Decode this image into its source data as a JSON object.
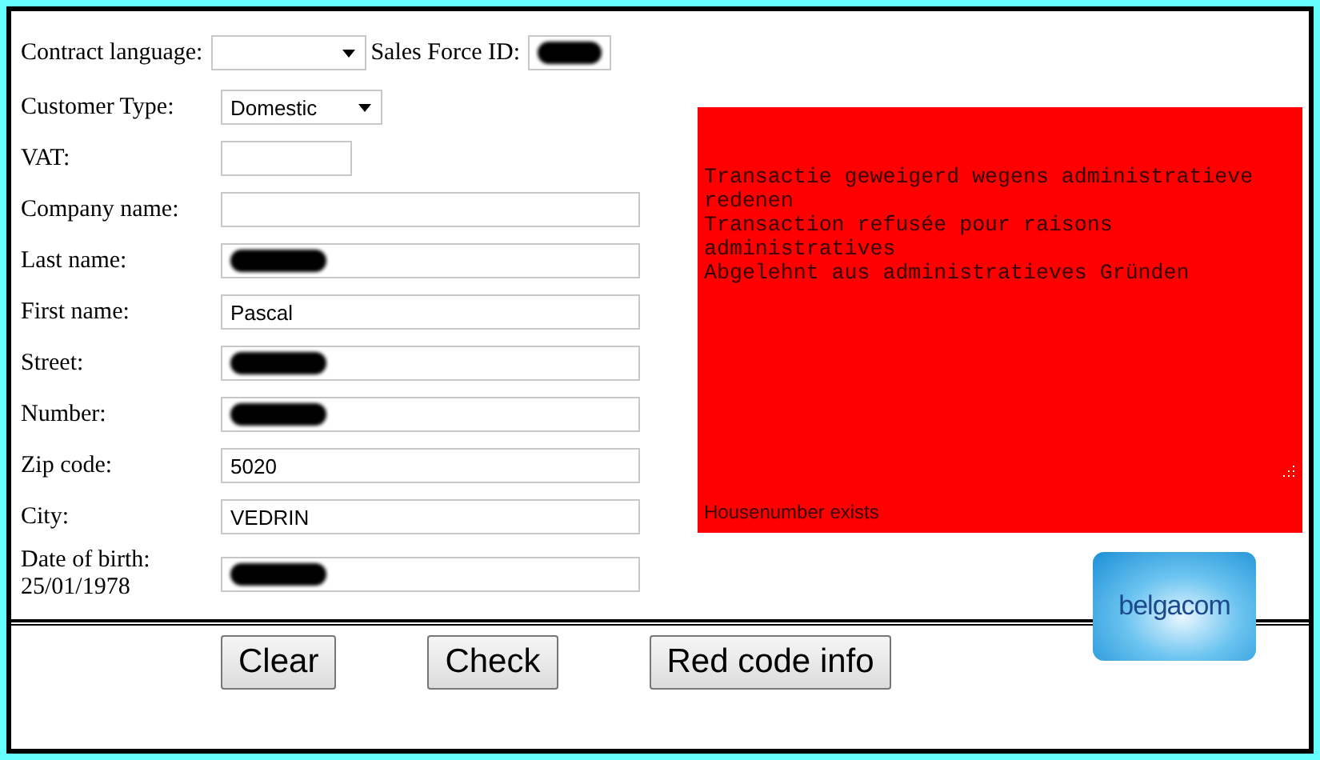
{
  "top_row": [
    {
      "kind": "select",
      "label": "Contract language:"
    },
    {
      "kind": "input",
      "label": "Sales Force ID:",
      "redacted": true
    }
  ],
  "fields": [
    {
      "kind": "select",
      "label": "Customer Type:",
      "value": "Domestic"
    },
    {
      "kind": "short",
      "label": "VAT:"
    },
    {
      "kind": "text",
      "label": "Company name:"
    },
    {
      "kind": "text",
      "label": "Last name:",
      "redacted": true
    },
    {
      "kind": "text",
      "label": "First name:",
      "value": "Pascal"
    },
    {
      "kind": "text",
      "label": "Street:",
      "redacted": true
    },
    {
      "kind": "text",
      "label": "Number:",
      "redacted": true
    },
    {
      "kind": "text",
      "label": "Zip code:",
      "value": "5020"
    },
    {
      "kind": "text",
      "label": "City:",
      "value": "VEDRIN"
    },
    {
      "kind": "text",
      "label": "Date of birth:",
      "note": "25/01/1978",
      "redacted": true
    }
  ],
  "message_panel": {
    "message": "Transactie geweigerd wegens administratieve redenen\nTransaction refusée pour raisons administratives\nAbgelehnt aus administratieves Gründen",
    "status": "Housenumber exists"
  },
  "logo": {
    "text": "belgacom"
  },
  "buttons": [
    "Clear",
    "Check",
    "Red code info"
  ]
}
